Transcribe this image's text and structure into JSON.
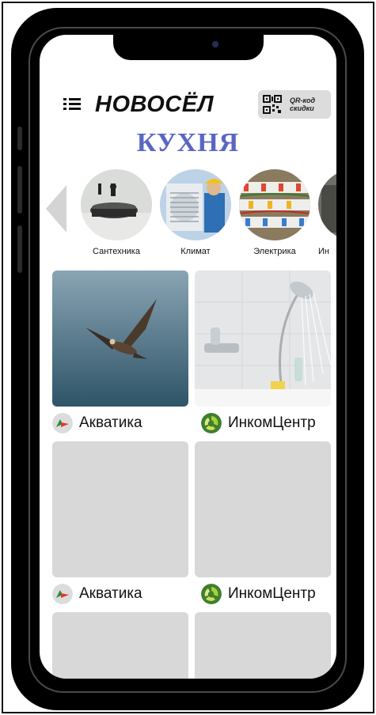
{
  "app": {
    "brand": "НОВОСЁЛ",
    "qr_label": "QR-код скидки"
  },
  "page": {
    "title": "КУХНЯ"
  },
  "categories": [
    {
      "label": "Сантехника",
      "icon": "sink-photo"
    },
    {
      "label": "Климат",
      "icon": "air-conditioner-photo"
    },
    {
      "label": "Электрика",
      "icon": "electrical-panel-photo"
    },
    {
      "label": "Ин",
      "icon": "partial-category-photo"
    }
  ],
  "products": [
    {
      "vendor": "Акватика",
      "image": "eagle-photo"
    },
    {
      "vendor": "ИнкомЦентр",
      "image": "shower-faucet-photo"
    },
    {
      "vendor": "Акватика",
      "image": "placeholder"
    },
    {
      "vendor": "ИнкомЦентр",
      "image": "placeholder"
    },
    {
      "vendor": "",
      "image": "placeholder"
    },
    {
      "vendor": "",
      "image": "placeholder"
    }
  ],
  "colors": {
    "title": "#5a66c2",
    "placeholder": "#d8d8d8",
    "qr_button": "#dcdcdc"
  }
}
